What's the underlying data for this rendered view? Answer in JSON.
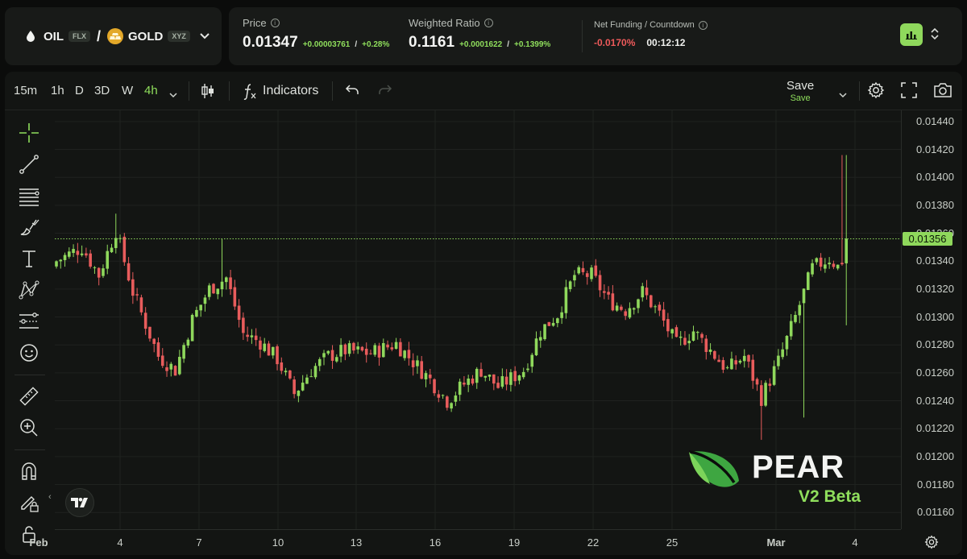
{
  "pair": {
    "base": "OIL",
    "base_badge": "FLX",
    "separator": "/",
    "quote": "GOLD",
    "quote_badge": "XYZ"
  },
  "stats": {
    "price_label": "Price",
    "price_value": "0.01347",
    "price_change_abs": "+0.00003761",
    "price_change_sep": "/",
    "price_change_pct": "+0.28%",
    "ratio_label": "Weighted Ratio",
    "ratio_value": "0.1161",
    "ratio_change_abs": "+0.0001622",
    "ratio_change_sep": "/",
    "ratio_change_pct": "+0.1399%",
    "funding_label": "Net Funding / Countdown",
    "funding_value": "-0.0170%",
    "countdown": "00:12:12"
  },
  "toolbar": {
    "timeframes": [
      "15m",
      "1h",
      "D",
      "3D",
      "W",
      "4h"
    ],
    "active_timeframe": "4h",
    "indicators_label": "Indicators",
    "save_label": "Save",
    "save_sub": "Save"
  },
  "icons": {
    "oil": "droplet-icon",
    "gold": "gold-bars-icon",
    "sidebar": [
      "crosshair-icon",
      "trend-line-icon",
      "fib-icon",
      "brush-icon",
      "text-icon",
      "pattern-icon",
      "forecast-icon",
      "emoji-icon",
      "ruler-icon",
      "zoom-in-icon",
      "magnet-icon",
      "pencil-lock-icon",
      "lock-icon"
    ]
  },
  "colors": {
    "accent": "#8fd85c",
    "up": "#8fd85c",
    "down": "#e85c5c",
    "background": "#131513"
  },
  "brand": {
    "name": "PEAR",
    "version": "V2 Beta"
  },
  "chart_data": {
    "type": "candlestick",
    "last_price_label": "0.01356",
    "y_ticks": [
      "0.01440",
      "0.01420",
      "0.01400",
      "0.01380",
      "0.01360",
      "0.01340",
      "0.01320",
      "0.01300",
      "0.01280",
      "0.01260",
      "0.01240",
      "0.01220",
      "0.01200",
      "0.01180",
      "0.01160"
    ],
    "x_ticks": [
      "Feb",
      "4",
      "7",
      "10",
      "13",
      "16",
      "19",
      "22",
      "25",
      "Mar",
      "4"
    ],
    "ylim": [
      0.01148,
      0.01448
    ],
    "last_price": 0.01356,
    "close_path": [
      [
        0,
        0.0134
      ],
      [
        6,
        0.0135
      ],
      [
        10,
        0.0133
      ],
      [
        14,
        0.01362
      ],
      [
        18,
        0.01318
      ],
      [
        24,
        0.01272
      ],
      [
        28,
        0.01262
      ],
      [
        32,
        0.01298
      ],
      [
        36,
        0.0132
      ],
      [
        40,
        0.01328
      ],
      [
        44,
        0.01288
      ],
      [
        48,
        0.01282
      ],
      [
        52,
        0.0127
      ],
      [
        56,
        0.01245
      ],
      [
        60,
        0.01262
      ],
      [
        64,
        0.01272
      ],
      [
        68,
        0.01276
      ],
      [
        74,
        0.01274
      ],
      [
        80,
        0.01281
      ],
      [
        84,
        0.01268
      ],
      [
        88,
        0.01255
      ],
      [
        92,
        0.0124
      ],
      [
        96,
        0.01252
      ],
      [
        100,
        0.01262
      ],
      [
        104,
        0.0125
      ],
      [
        110,
        0.01262
      ],
      [
        114,
        0.0129
      ],
      [
        118,
        0.01302
      ],
      [
        122,
        0.0133
      ],
      [
        126,
        0.0133
      ],
      [
        130,
        0.01312
      ],
      [
        134,
        0.01305
      ],
      [
        138,
        0.01318
      ],
      [
        142,
        0.01302
      ],
      [
        146,
        0.0128
      ],
      [
        150,
        0.0129
      ],
      [
        154,
        0.01276
      ],
      [
        158,
        0.01262
      ],
      [
        162,
        0.01272
      ],
      [
        166,
        0.01242
      ],
      [
        170,
        0.01268
      ],
      [
        174,
        0.013
      ],
      [
        178,
        0.01335
      ],
      [
        182,
        0.01342
      ],
      [
        184,
        0.01336
      ],
      [
        186,
        0.01345
      ]
    ]
  }
}
